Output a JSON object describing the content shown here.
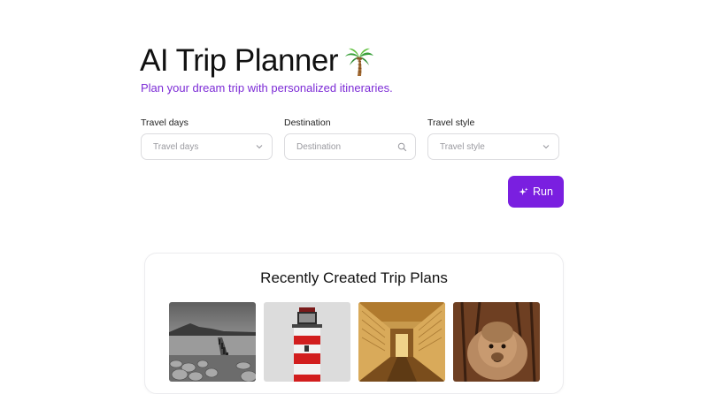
{
  "header": {
    "title": "AI Trip Planner",
    "title_icon": "palm-tree-icon",
    "subtitle": "Plan your dream trip with personalized itineraries."
  },
  "form": {
    "travel_days": {
      "label": "Travel days",
      "placeholder": "Travel days",
      "icon": "chevron-down-icon"
    },
    "destination": {
      "label": "Destination",
      "placeholder": "Destination",
      "icon": "search-icon"
    },
    "travel_style": {
      "label": "Travel style",
      "placeholder": "Travel style",
      "icon": "chevron-down-icon"
    },
    "run_label": "Run",
    "run_icon": "sparkle-icon"
  },
  "recent": {
    "title": "Recently Created Trip Plans",
    "items": [
      {
        "image": "pier-seascape-image"
      },
      {
        "image": "lighthouse-image"
      },
      {
        "image": "temple-corridor-image"
      },
      {
        "image": "alpaca-image"
      }
    ]
  },
  "colors": {
    "accent": "#7a1fe0",
    "subtitle": "#7c2bd6",
    "border": "#dcdcdf"
  }
}
